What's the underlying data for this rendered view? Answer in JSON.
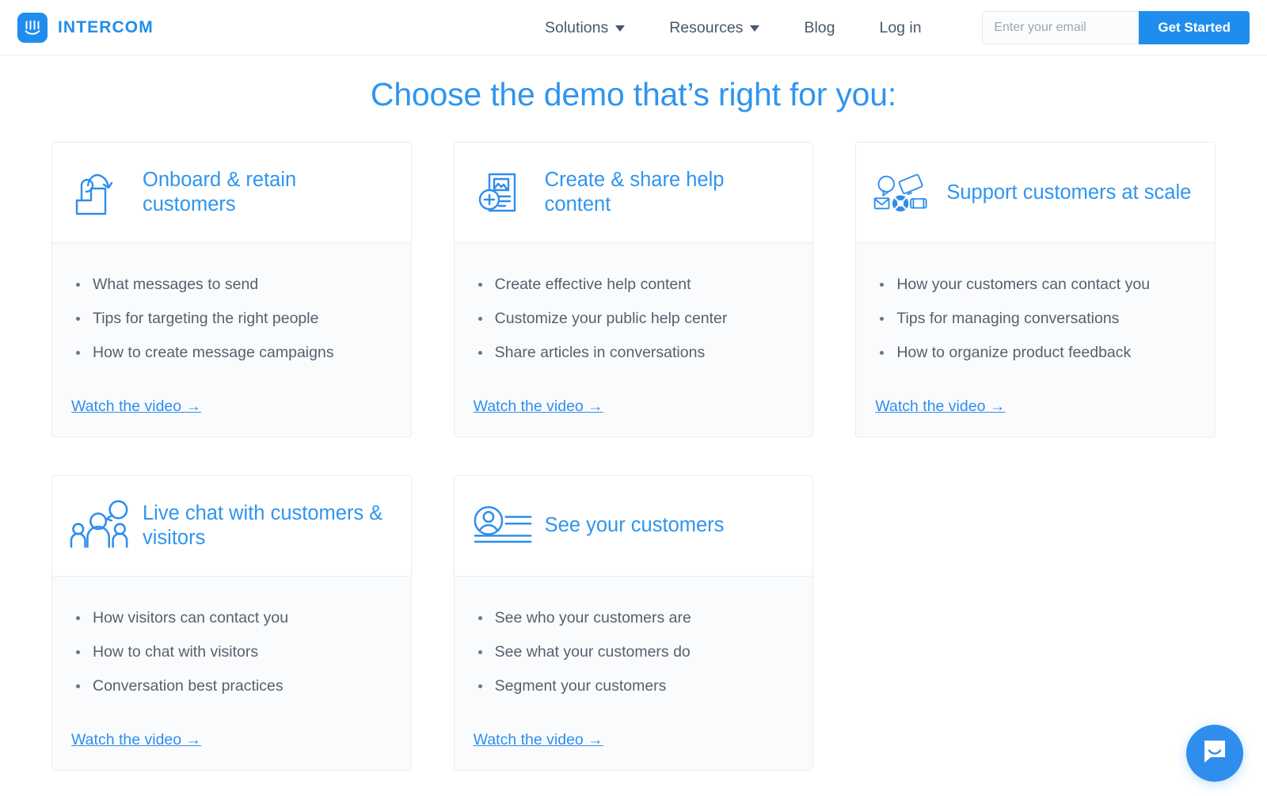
{
  "header": {
    "brand_name": "INTERCOM",
    "logo_icon": "intercom-logo-icon",
    "nav": [
      {
        "label": "Solutions",
        "has_caret": true
      },
      {
        "label": "Resources",
        "has_caret": true
      },
      {
        "label": "Blog",
        "has_caret": false
      },
      {
        "label": "Log in",
        "has_caret": false
      }
    ],
    "email_placeholder": "Enter your email",
    "email_value": "",
    "cta_label": "Get Started"
  },
  "page_title": "Choose the demo that’s right for you:",
  "colors": {
    "brand_blue": "#1f8ded",
    "title_blue": "#2f95ee",
    "link_blue": "#2f8ded",
    "body_text": "#56606d",
    "nav_text": "#48586b",
    "card_border": "#e9edf2",
    "card_body_bg": "#fafbfc"
  },
  "cards": [
    {
      "icon": "stairs-arrow-icon",
      "title": "Onboard & retain customers",
      "bullets": [
        "What messages to send",
        "Tips for targeting the right people",
        "How to create message campaigns"
      ],
      "link_label": "Watch the video →"
    },
    {
      "icon": "document-plus-icon",
      "title": "Create & share help content",
      "bullets": [
        "Create effective help content",
        "Customize your public help center",
        "Share articles in conversations"
      ],
      "link_label": "Watch the video →"
    },
    {
      "icon": "support-channels-icon",
      "title": "Support customers at scale",
      "bullets": [
        "How your customers can contact you",
        "Tips for managing conversations",
        "How to organize product feedback"
      ],
      "link_label": "Watch the video →"
    },
    {
      "icon": "people-chat-icon",
      "title": "Live chat with customers & visitors",
      "bullets": [
        "How visitors can contact you",
        "How to chat with visitors",
        "Conversation best practices"
      ],
      "link_label": "Watch the video →"
    },
    {
      "icon": "user-profile-lines-icon",
      "title": "See your customers",
      "bullets": [
        "See who your customers are",
        "See what your customers do",
        "Segment your customers"
      ],
      "link_label": "Watch the video →"
    }
  ],
  "messenger": {
    "icon": "messenger-bubble-icon"
  }
}
